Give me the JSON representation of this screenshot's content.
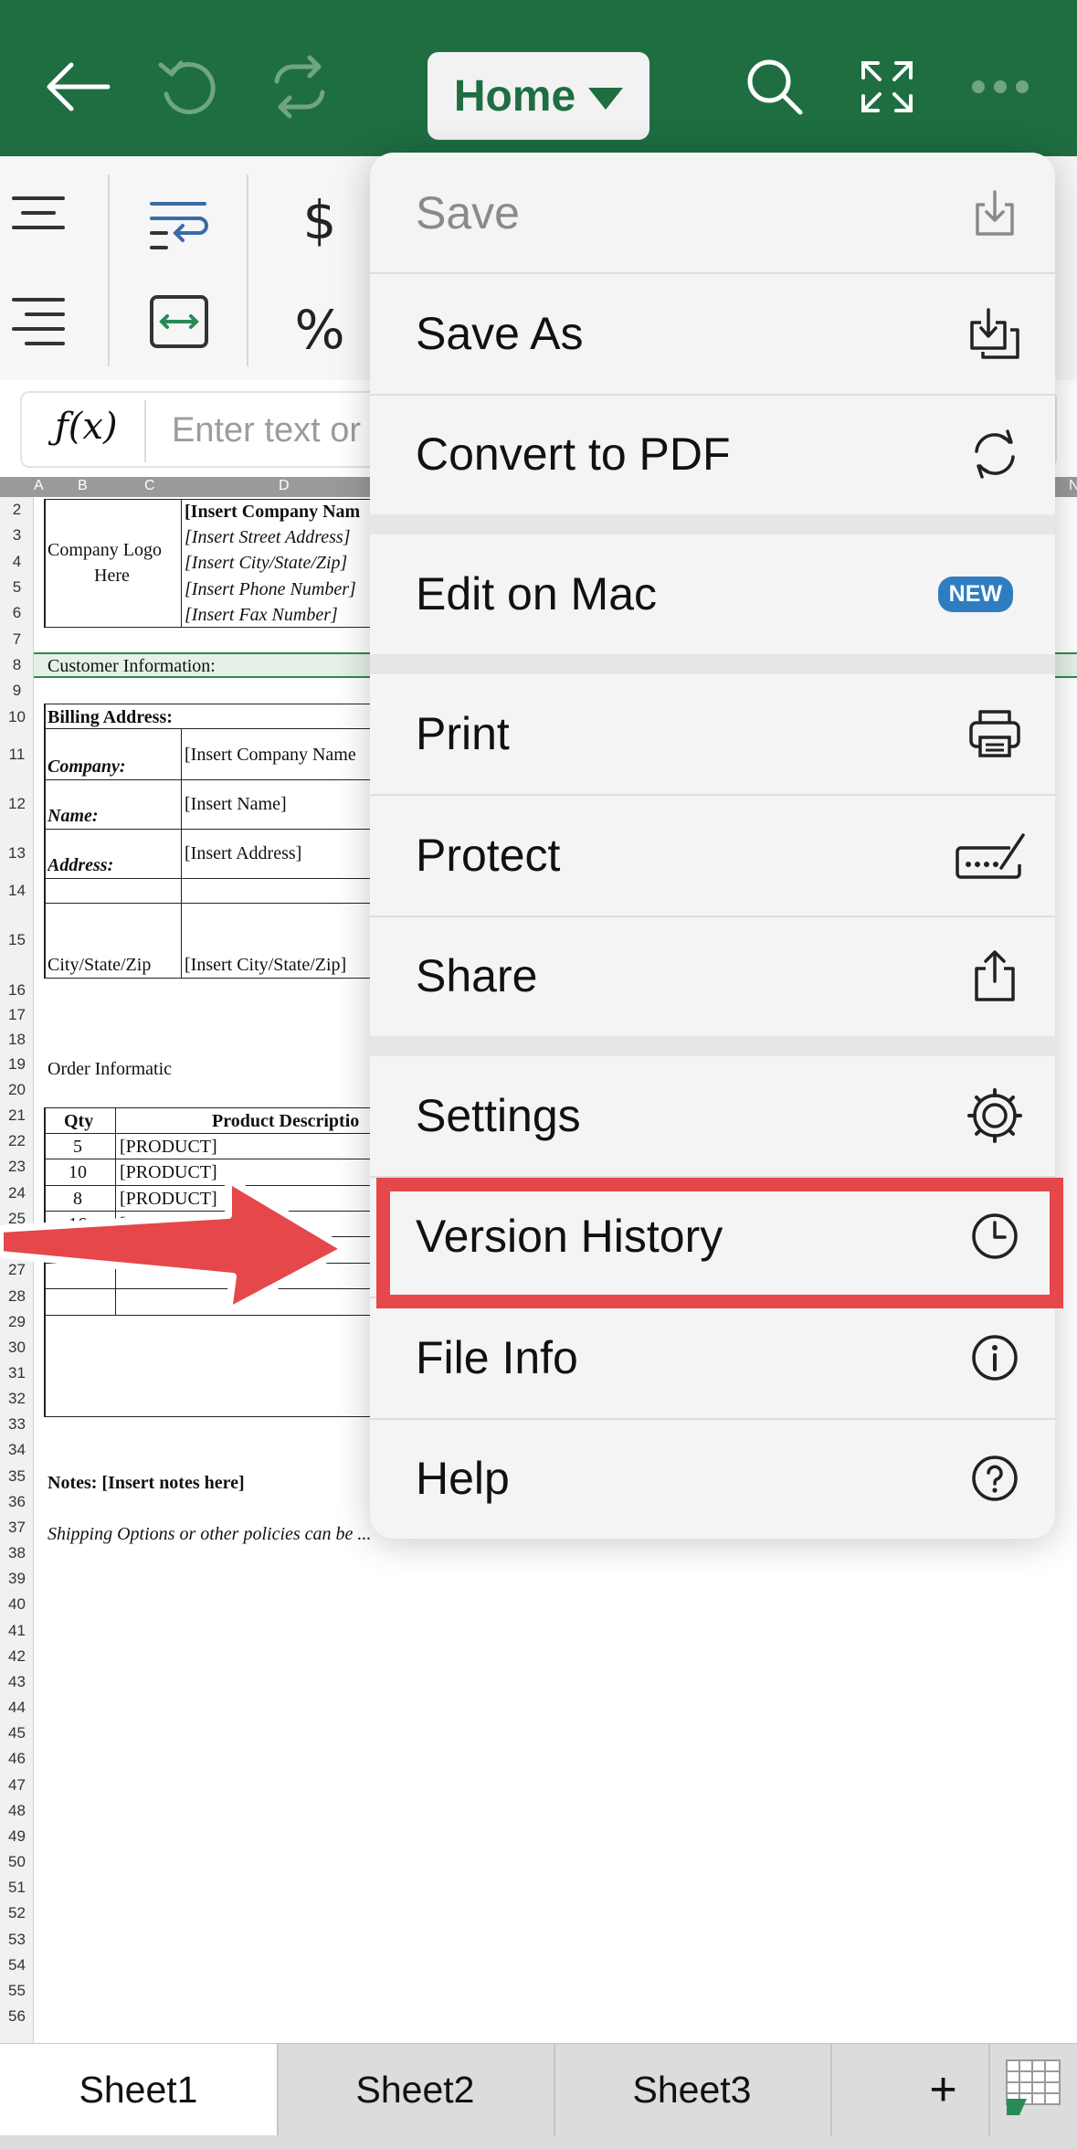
{
  "toolbar": {
    "back": "back-arrow-icon",
    "undo": "undo-icon",
    "redo": "redo-icon",
    "tab_label": "Home",
    "search": "search-icon",
    "fullscreen": "fullscreen-icon",
    "more": "more-icon",
    "brand_color": "#1e6e42"
  },
  "ribbon": {
    "currency_symbol": "$",
    "percent_symbol": "%"
  },
  "formula": {
    "fx_label": "ƒ(x)",
    "placeholder": "Enter text or"
  },
  "sheet": {
    "col_headers": [
      "A",
      "B",
      "C",
      "D",
      "N"
    ],
    "row_numbers": [
      "2",
      "3",
      "4",
      "5",
      "6",
      "7",
      "8",
      "9",
      "10",
      "11",
      "12",
      "13",
      "14",
      "15",
      "16",
      "17",
      "18",
      "19",
      "20",
      "21",
      "22",
      "23",
      "24",
      "25",
      "26",
      "27",
      "28",
      "29",
      "30",
      "31",
      "32",
      "33",
      "34",
      "35",
      "36",
      "37",
      "38",
      "39",
      "40",
      "41",
      "42",
      "43",
      "44",
      "45",
      "46",
      "47",
      "48",
      "49",
      "50",
      "51",
      "52",
      "53",
      "54",
      "55",
      "56"
    ],
    "logo_line1": "Company Logo",
    "logo_line2": "Here",
    "company_name": "[Insert Company Nam",
    "street": "[Insert Street Address]",
    "city": "[Insert City/State/Zip]",
    "phone": "[Insert Phone Number]",
    "fax": "[Insert Fax Number]",
    "customer_info": "Customer Information:",
    "billing": "Billing Address:",
    "company_label": "Company:",
    "company_value": "[Insert Company Name",
    "name_label": "Name:",
    "name_value": "[Insert Name]",
    "address_label": "Address:",
    "address_value": "[Insert Address]",
    "city_label": "City/State/Zip",
    "city_value": "[Insert City/State/Zip]",
    "order_info": "Order Informatic",
    "qty_header": "Qty",
    "product_header": "Product Descriptio",
    "orders": [
      {
        "qty": "5",
        "product": "[PRODUCT]"
      },
      {
        "qty": "10",
        "product": "[PRODUCT]"
      },
      {
        "qty": "8",
        "product": "[PRODUCT]"
      },
      {
        "qty": "16",
        "product": "[PRO"
      }
    ],
    "notes": "Notes: [Insert notes here]",
    "shipping": "Shipping Options or other policies can be ..."
  },
  "menu": {
    "save": "Save",
    "save_as": "Save As",
    "convert_pdf": "Convert to PDF",
    "edit_on_mac": "Edit on Mac",
    "new_badge": "NEW",
    "print": "Print",
    "protect": "Protect",
    "share": "Share",
    "settings": "Settings",
    "version_history": "Version History",
    "file_info": "File Info",
    "help": "Help",
    "badge_color": "#2f7dc0",
    "highlight_color": "#e5474a"
  },
  "sheets": {
    "tabs": [
      "Sheet1",
      "Sheet2",
      "Sheet3"
    ],
    "add": "+"
  }
}
